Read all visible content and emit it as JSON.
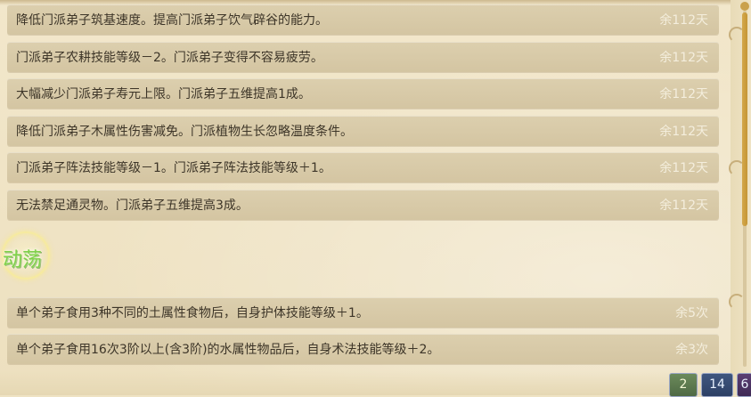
{
  "effects_list": {
    "rows": [
      {
        "text": "降低门派弟子筑基速度。提高门派弟子饮气辟谷的能力。",
        "remain": "余112天"
      },
      {
        "text": "门派弟子农耕技能等级－2。门派弟子变得不容易疲劳。",
        "remain": "余112天"
      },
      {
        "text": "大幅减少门派弟子寿元上限。门派弟子五维提高1成。",
        "remain": "余112天"
      },
      {
        "text": "降低门派弟子木属性伤害减免。门派植物生长忽略温度条件。",
        "remain": "余112天"
      },
      {
        "text": "门派弟子阵法技能等级－1。门派弟子阵法技能等级＋1。",
        "remain": "余112天"
      },
      {
        "text": "无法禁足通灵物。门派弟子五维提高3成。",
        "remain": "余112天"
      }
    ]
  },
  "turmoil_section": {
    "title": "动荡",
    "rows": [
      {
        "text": "单个弟子食用3种不同的土属性食物后，自身护体技能等级＋1。",
        "remain": "余5次"
      },
      {
        "text": "单个弟子食用16次3阶以上(含3阶)的水属性物品后，自身术法技能等级＋2。",
        "remain": "余3次"
      }
    ]
  },
  "corner_badges": [
    "2",
    "14",
    "6"
  ],
  "colors": {
    "panel_bg": "#efe3c4",
    "row_bg": "#d8caa7",
    "text": "#3d3528",
    "remain_text": "#f4eedd",
    "section_title": "#7fd14a",
    "scrollbar": "#c9a04a"
  }
}
